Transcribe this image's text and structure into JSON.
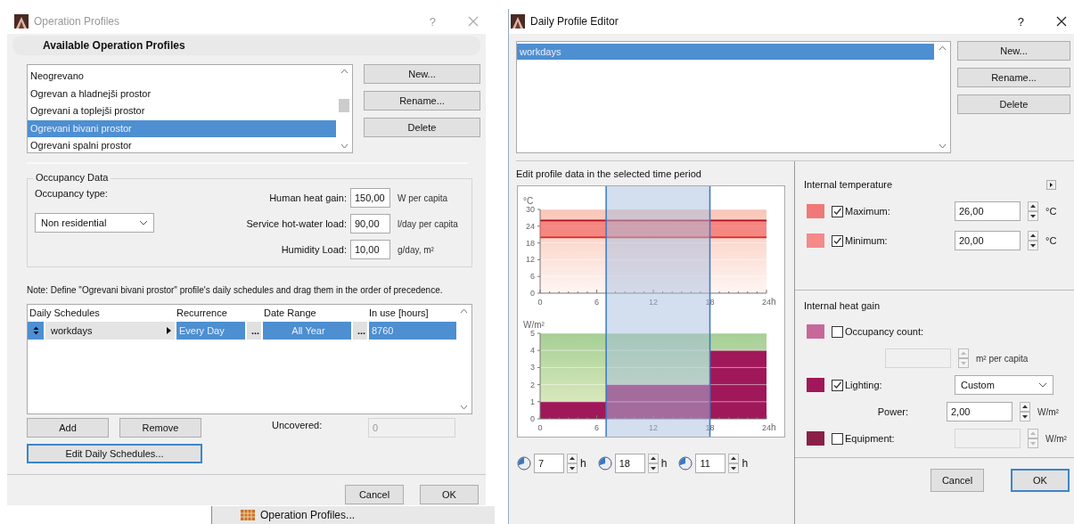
{
  "operation_profiles": {
    "title": "Operation Profiles",
    "help": "?",
    "header": "Available Operation Profiles",
    "profiles": [
      {
        "label": "Neogrevano",
        "selected": false
      },
      {
        "label": "Ogrevan a hladnejši prostor",
        "selected": false
      },
      {
        "label": "Ogrevani a toplejši prostor",
        "selected": false
      },
      {
        "label": "Ogrevani bivani prostor",
        "selected": true
      },
      {
        "label": "Ogrevani spalni prostor",
        "selected": false
      }
    ],
    "buttons": [
      "New...",
      "Rename...",
      "Delete"
    ],
    "occupancy": {
      "legend": "Occupancy Data",
      "type_label": "Occupancy type:",
      "type_value": "Non residential",
      "fields": [
        {
          "label": "Human heat gain:",
          "value": "150,00",
          "unit": "W per capita"
        },
        {
          "label": "Service hot-water load:",
          "value": "90,00",
          "unit": "l/day per capita"
        },
        {
          "label": "Humidity Load:",
          "value": "10,00",
          "unit": "g/day, m²"
        }
      ]
    },
    "note": "Note: Define \"Ogrevani bivani prostor\" profile's daily schedules and drag them in the order of precedence.",
    "schedules": {
      "columns": [
        "Daily Schedules",
        "Recurrence",
        "Date Range",
        "In use [hours]"
      ],
      "rows": [
        {
          "name": "workdays",
          "recurrence": "Every Day",
          "recurrence_button": "...",
          "date_range": "All Year",
          "date_button": "...",
          "in_use": "8760",
          "selected": true
        }
      ]
    },
    "add": "Add",
    "remove": "Remove",
    "uncovered_label": "Uncovered:",
    "uncovered_value": "0",
    "edit_button": "Edit Daily Schedules...",
    "cancel": "Cancel",
    "ok": "OK"
  },
  "background_menu_item": "Operation Profiles...",
  "daily_profile_editor": {
    "title": "Daily Profile Editor",
    "help": "?",
    "profiles": [
      {
        "label": "workdays",
        "selected": true
      }
    ],
    "buttons": [
      "New...",
      "Rename...",
      "Delete"
    ],
    "section_label": "Edit profile data in the selected time period",
    "temperature_chart": {
      "chart_data": {
        "type": "line",
        "ylabel": "°C",
        "xlabel": "h",
        "x": [
          0,
          24
        ],
        "xlim": [
          0,
          24
        ],
        "ylim": [
          0,
          30
        ],
        "xticks": [
          0,
          6,
          12,
          18,
          24
        ],
        "yticks": [
          0,
          6,
          12,
          18,
          24,
          30
        ],
        "grid": true,
        "series": [
          {
            "color": "#b01020",
            "values": [
              26,
              26
            ]
          },
          {
            "color": "#e02828",
            "values": [
              20,
              20
            ]
          }
        ]
      }
    },
    "heat_chart": {
      "chart_data": {
        "type": "area",
        "ylabel": "W/m²",
        "xlabel": "h",
        "x": [
          0,
          7,
          7,
          18,
          18,
          24
        ],
        "xlim": [
          0,
          24
        ],
        "ylim": [
          0,
          5
        ],
        "xticks": [
          0,
          6,
          12,
          18,
          24
        ],
        "yticks": [
          0,
          1,
          2,
          3,
          4,
          5
        ],
        "grid": true,
        "series": [
          {
            "color": "#a0185a",
            "values": [
              1,
              1,
              2,
              2,
              4,
              4
            ]
          }
        ]
      }
    },
    "time_fields": [
      {
        "value": "7",
        "unit": "h"
      },
      {
        "value": "18",
        "unit": "h"
      },
      {
        "value": "11",
        "unit": "h"
      }
    ],
    "temperature": {
      "title": "Internal temperature",
      "rows": [
        {
          "label": "Maximum:",
          "checked": true,
          "value": "26,00",
          "unit": "°C",
          "color": "#f07878"
        },
        {
          "label": "Minimum:",
          "checked": true,
          "value": "20,00",
          "unit": "°C",
          "color": "#f48a8a"
        }
      ]
    },
    "heat_gain": {
      "title": "Internal heat gain",
      "rows": [
        {
          "kind": "check",
          "label": "Occupancy count:",
          "checked": false,
          "color": "#c8689a"
        },
        {
          "kind": "sub_field",
          "unit": "m² per capita",
          "disabled": true
        },
        {
          "kind": "check_select",
          "label": "Lighting:",
          "checked": true,
          "color": "#a0185a",
          "option": "Custom"
        },
        {
          "kind": "sub_field",
          "label": "Power:",
          "value": "2,00",
          "unit": "W/m²",
          "disabled": false
        },
        {
          "kind": "check_field",
          "label": "Equipment:",
          "checked": false,
          "color": "#8a2048",
          "unit": "W/m²",
          "disabled": true
        }
      ]
    },
    "cancel": "Cancel",
    "ok": "OK"
  }
}
